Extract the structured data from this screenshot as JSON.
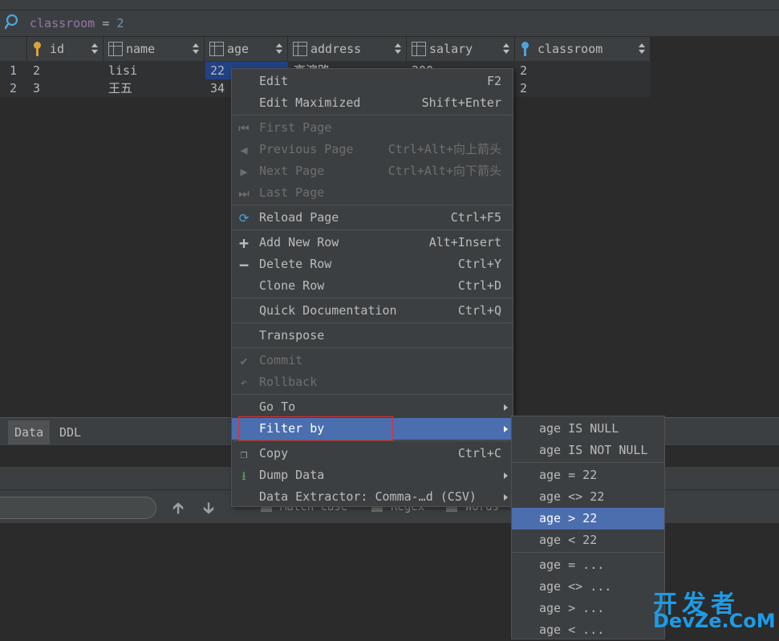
{
  "filter": {
    "column": "classroom",
    "operator": "=",
    "value": "2"
  },
  "grid": {
    "columns": [
      {
        "name": "id",
        "icon": "key-icon"
      },
      {
        "name": "name",
        "icon": "column-icon"
      },
      {
        "name": "age",
        "icon": "column-icon"
      },
      {
        "name": "address",
        "icon": "column-icon"
      },
      {
        "name": "salary",
        "icon": "column-icon"
      },
      {
        "name": "classroom",
        "icon": "foreign-key-icon"
      }
    ],
    "rows": [
      {
        "num": "1",
        "id": "2",
        "name": "lisi",
        "age": "22",
        "address": "高滨路",
        "salary": "200",
        "classroom": "2"
      },
      {
        "num": "2",
        "id": "3",
        "name": "王五",
        "age": "34",
        "address": "",
        "salary": "",
        "classroom": "2"
      }
    ]
  },
  "lower_panel": {
    "tabs": [
      "Data",
      "DDL"
    ],
    "options": [
      "Match Case",
      "Regex",
      "Words"
    ]
  },
  "context_menu": {
    "items": [
      {
        "label": "Edit",
        "shortcut": "F2"
      },
      {
        "label": "Edit Maximized",
        "shortcut": "Shift+Enter"
      },
      {
        "label": "First Page",
        "shortcut": ""
      },
      {
        "label": "Previous Page",
        "shortcut": "Ctrl+Alt+向上箭头"
      },
      {
        "label": "Next Page",
        "shortcut": "Ctrl+Alt+向下箭头"
      },
      {
        "label": "Last Page",
        "shortcut": ""
      },
      {
        "label": "Reload Page",
        "shortcut": "Ctrl+F5"
      },
      {
        "label": "Add New Row",
        "shortcut": "Alt+Insert"
      },
      {
        "label": "Delete Row",
        "shortcut": "Ctrl+Y"
      },
      {
        "label": "Clone Row",
        "shortcut": "Ctrl+D"
      },
      {
        "label": "Quick Documentation",
        "shortcut": "Ctrl+Q"
      },
      {
        "label": "Transpose",
        "shortcut": ""
      },
      {
        "label": "Commit",
        "shortcut": ""
      },
      {
        "label": "Rollback",
        "shortcut": ""
      },
      {
        "label": "Go To",
        "shortcut": ""
      },
      {
        "label": "Filter by",
        "shortcut": ""
      },
      {
        "label": "Copy",
        "shortcut": "Ctrl+C"
      },
      {
        "label": "Dump Data",
        "shortcut": ""
      },
      {
        "label": "Data Extractor: Comma-…d (CSV)",
        "shortcut": ""
      }
    ]
  },
  "submenu": {
    "items": [
      "age IS NULL",
      "age IS NOT NULL",
      "age = 22",
      "age <> 22",
      "age > 22",
      "age < 22",
      "age = ...",
      "age <> ...",
      "age > ...",
      "age < ..."
    ]
  },
  "watermark": {
    "line1": "开发者",
    "line2": "DevZe.CoM"
  },
  "colors": {
    "background": "#2b2b2b",
    "panel": "#3c3f41",
    "highlight": "#4b6eaf",
    "selection": "#214283",
    "red_box": "#e03030",
    "watermark": "#1e9be6"
  }
}
